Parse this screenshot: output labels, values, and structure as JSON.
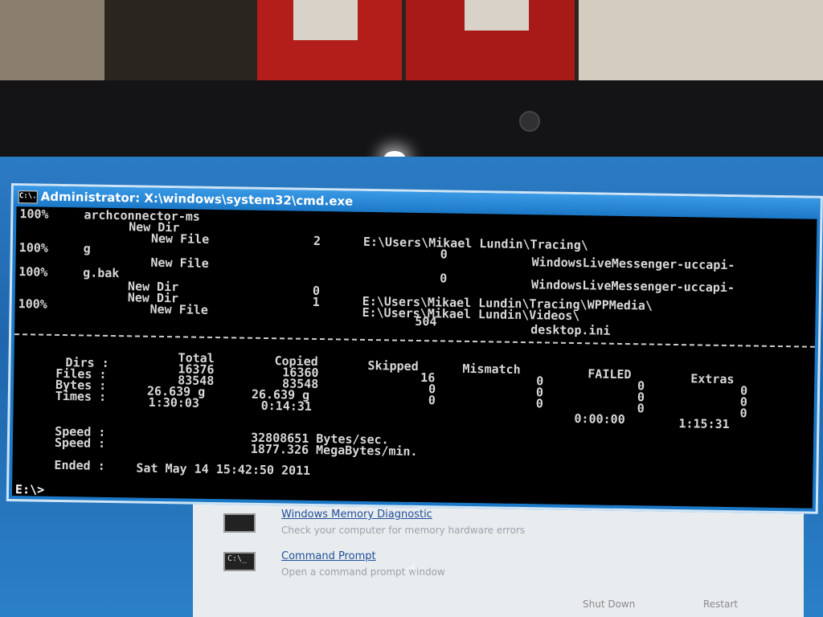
{
  "window": {
    "title": "Administrator: X:\\windows\\system32\\cmd.exe",
    "icon_text": "C:\\."
  },
  "log": {
    "r1": {
      "pct": "100%",
      "name": "archconnector-ms"
    },
    "r2": {
      "type": "New Dir"
    },
    "r3": {
      "type": "New File",
      "count": "2",
      "path": "E:\\Users\\Mikael Lundin\\Tracing\\"
    },
    "r4": {
      "pct": "100%",
      "name": "g",
      "size": "0",
      "path": "WindowsLiveMessenger-uccapi-"
    },
    "r5": {
      "type": "New File"
    },
    "r6": {
      "pct": "100%",
      "name": "g.bak",
      "size": "0",
      "path": "WindowsLiveMessenger-uccapi-"
    },
    "r7": {
      "type": "New Dir",
      "count": "0",
      "path": "E:\\Users\\Mikael Lundin\\Tracing\\WPPMedia\\"
    },
    "r8": {
      "type": "New Dir",
      "count": "1",
      "path": "E:\\Users\\Mikael Lundin\\Videos\\"
    },
    "r9": {
      "pct": "100%",
      "type": "New File",
      "size": "504",
      "path": "desktop.ini"
    }
  },
  "summary": {
    "headers": [
      "Total",
      "Copied",
      "Skipped",
      "Mismatch",
      "FAILED",
      "Extras"
    ],
    "rows": [
      {
        "label": "Dirs :",
        "values": [
          "16376",
          "16360",
          "16",
          "0",
          "0",
          "0"
        ]
      },
      {
        "label": "Files :",
        "values": [
          "83548",
          "83548",
          "0",
          "0",
          "0",
          "0"
        ]
      },
      {
        "label": "Bytes :",
        "values": [
          "26.639 g",
          "26.639 g",
          "0",
          "0",
          "0",
          "0"
        ]
      },
      {
        "label": "Times :",
        "values": [
          "1:30:03",
          "0:14:31",
          "",
          "",
          "0:00:00",
          "1:15:31"
        ]
      }
    ],
    "speed1_label": "Speed :",
    "speed1_value": "32808651 Bytes/sec.",
    "speed2_label": "Speed :",
    "speed2_value": "1877.326 MegaBytes/min.",
    "ended_label": "Ended :",
    "ended_value": "Sat May 14 15:42:50 2011"
  },
  "prompt": "E:\\>",
  "panel": {
    "item1_title": "Windows Memory Diagnostic",
    "item1_desc": "Check your computer for memory hardware errors",
    "item2_title": "Command Prompt",
    "item2_desc": "Open a command prompt window",
    "shutdown_label": "Shut Down",
    "restart_label": "Restart",
    "icon_text": "C:\\_"
  }
}
